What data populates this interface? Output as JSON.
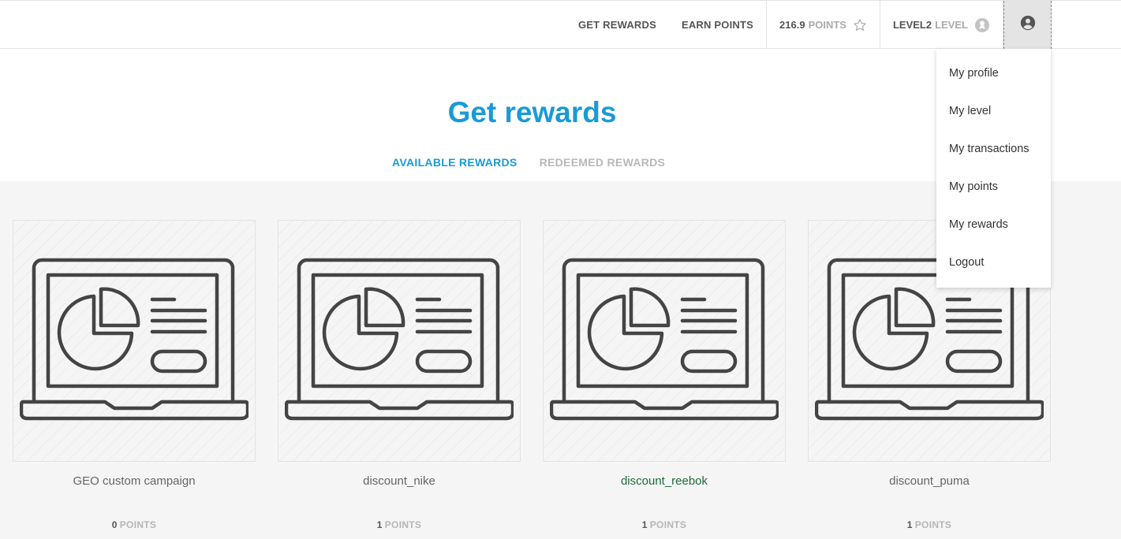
{
  "nav": {
    "get_rewards": "GET REWARDS",
    "earn_points": "EARN POINTS",
    "points_value": "216.9",
    "points_unit": "POINTS",
    "level_value": "LEVEL2",
    "level_unit": "LEVEL"
  },
  "menu": {
    "items": [
      {
        "label": "My profile"
      },
      {
        "label": "My level"
      },
      {
        "label": "My transactions"
      },
      {
        "label": "My points"
      },
      {
        "label": "My rewards"
      },
      {
        "label": "Logout"
      }
    ]
  },
  "page": {
    "title": "Get rewards",
    "tab_available": "AVAILABLE REWARDS",
    "tab_redeemed": "REDEEMED REWARDS"
  },
  "rewards": [
    {
      "name": "GEO custom campaign",
      "points": "0",
      "unit": "POINTS"
    },
    {
      "name": "discount_nike",
      "points": "1",
      "unit": "POINTS"
    },
    {
      "name": "discount_reebok",
      "points": "1",
      "unit": "POINTS"
    },
    {
      "name": "discount_puma",
      "points": "1",
      "unit": "POINTS"
    }
  ],
  "colors": {
    "accent": "#1a9ad6",
    "highlight_name": "#1d6b3a",
    "muted": "#b8b8b8"
  }
}
